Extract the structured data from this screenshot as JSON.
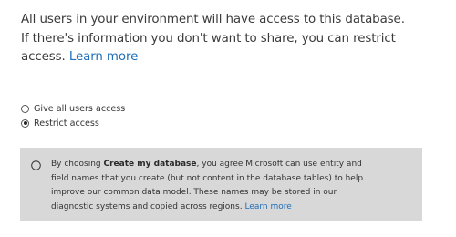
{
  "intro": {
    "line1": "All users in your environment will have access to this database.",
    "line2": "If there's information you don't want to share, you can restrict",
    "line3_prefix": "access. ",
    "learn_more": "Learn more"
  },
  "access_options": [
    {
      "label": "Give all users access",
      "selected": false
    },
    {
      "label": "Restrict access",
      "selected": true
    }
  ],
  "notice": {
    "line1_prefix": "By choosing ",
    "line1_bold": "Create my database",
    "line1_suffix": ", you agree Microsoft can use entity and",
    "line2": "field names that you create (but not content in the database tables) to help",
    "line3": "improve our common data model. These names may be stored in our",
    "line4_prefix": "diagnostic systems and copied across regions. ",
    "learn_more": "Learn more"
  },
  "colors": {
    "link": "#1f6fb8",
    "notice_background": "#d8d8d8",
    "text": "#333333"
  },
  "icons": {
    "notice_icon": "info-icon"
  }
}
